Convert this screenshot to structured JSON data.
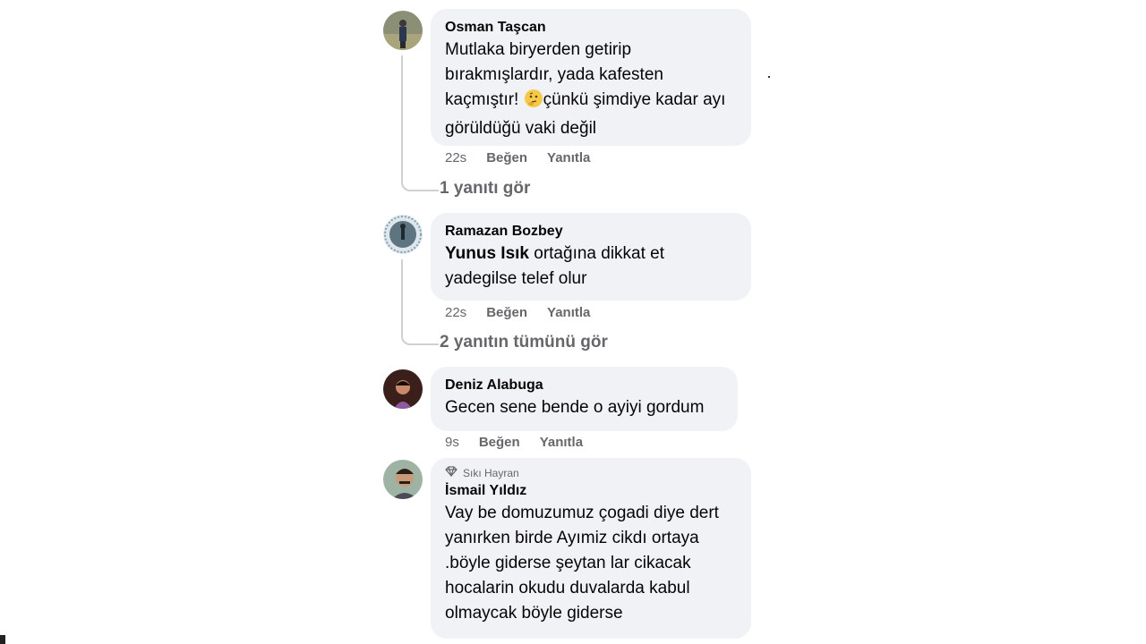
{
  "comments": [
    {
      "author": "Osman Taşcan",
      "text_before_emoji": "Mutlaka biryerden getirip bırakmışlardır, yada kafesten kaçmıştır! ",
      "text_after_emoji": "çünkü şimdiye kadar ayı görüldüğü vaki değil",
      "emoji": "thinking-face",
      "time": "22s",
      "like": "Beğen",
      "reply": "Yanıtla",
      "replies_link": "1 yanıtı gör"
    },
    {
      "author": "Ramazan Bozbey",
      "mention": "Yunus Isık",
      "text": " ortağına dikkat et yadegilse telef olur",
      "time": "22s",
      "like": "Beğen",
      "reply": "Yanıtla",
      "replies_link": "2 yanıtın tümünü gör"
    },
    {
      "author": "Deniz Alabuga",
      "text": "Gecen sene bende o ayiyi gordum",
      "time": "9s",
      "like": "Beğen",
      "reply": "Yanıtla"
    },
    {
      "badge": "Sıkı Hayran",
      "badge_icon": "diamond-icon",
      "author": "İsmail Yıldız",
      "text": "Vay be domuzumuz çogadi diye dert yanırken birde Ayımiz cikdı ortaya .böyle giderse şeytan lar cikacak hocalarin okudu duvalarda kabul olmaycak böyle giderse"
    }
  ],
  "colors": {
    "bubble": "#f0f2f5",
    "secondary_text": "#65676b",
    "thread_line": "#ced0d4"
  }
}
